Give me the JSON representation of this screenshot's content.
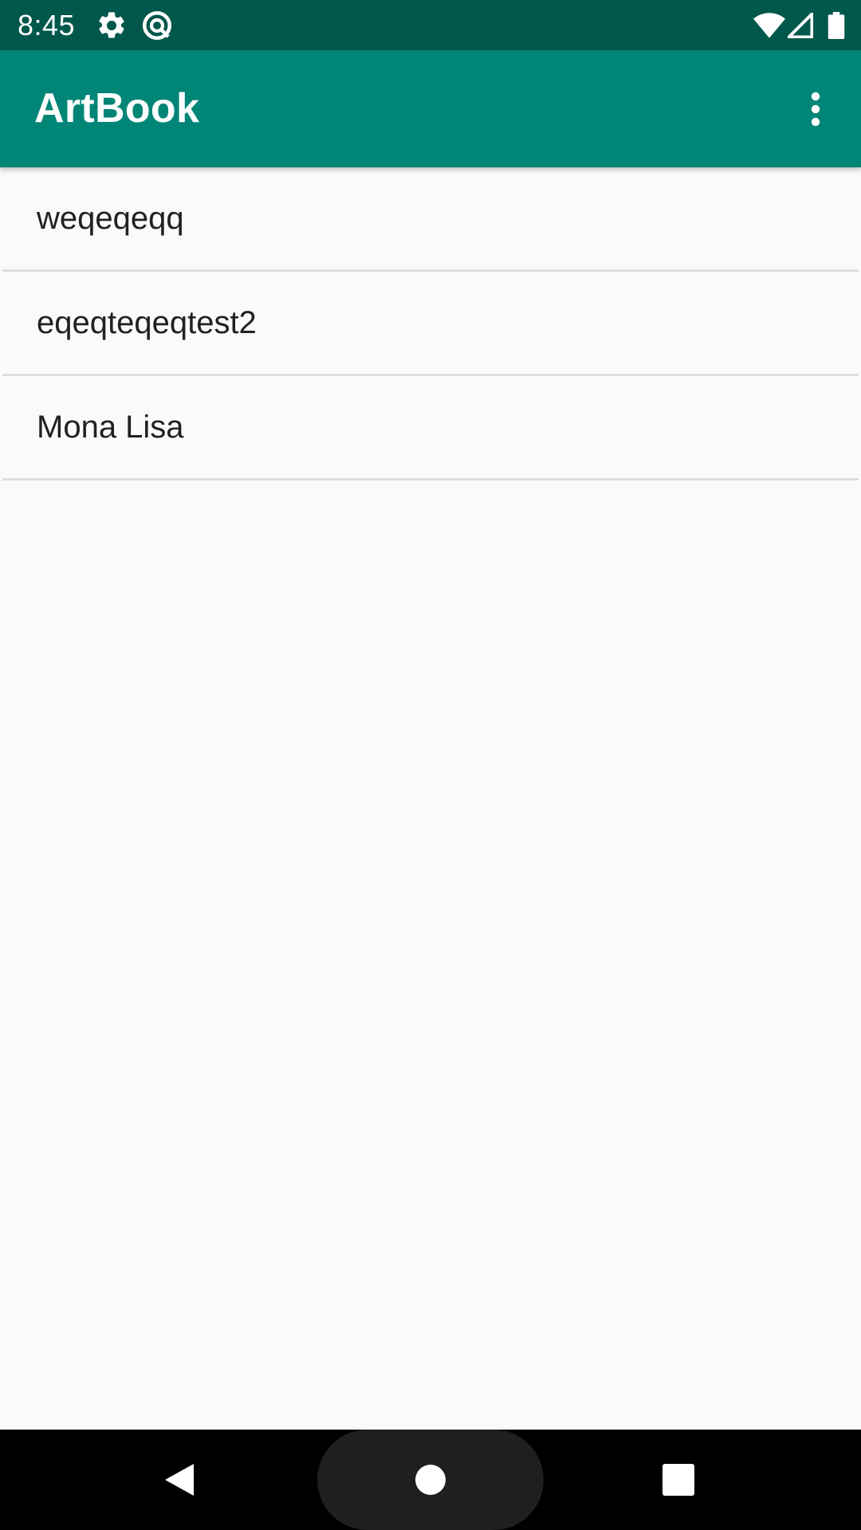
{
  "status_bar": {
    "time": "8:45",
    "icons": [
      "settings-icon",
      "data-saver-icon",
      "wifi-icon",
      "cell-signal-icon",
      "battery-icon"
    ]
  },
  "app_bar": {
    "title": "ArtBook",
    "overflow_icon": "more-vert-icon"
  },
  "list": {
    "items": [
      {
        "label": "weqeqeqq"
      },
      {
        "label": "eqeqteqeqtest2"
      },
      {
        "label": "Mona Lisa"
      }
    ]
  },
  "nav_bar": {
    "buttons": [
      "back-icon",
      "home-icon",
      "recents-icon"
    ]
  },
  "colors": {
    "status_bar": "#00574b",
    "app_bar": "#008577",
    "background": "#fafafa",
    "divider": "#dddddd",
    "text": "#212121"
  }
}
